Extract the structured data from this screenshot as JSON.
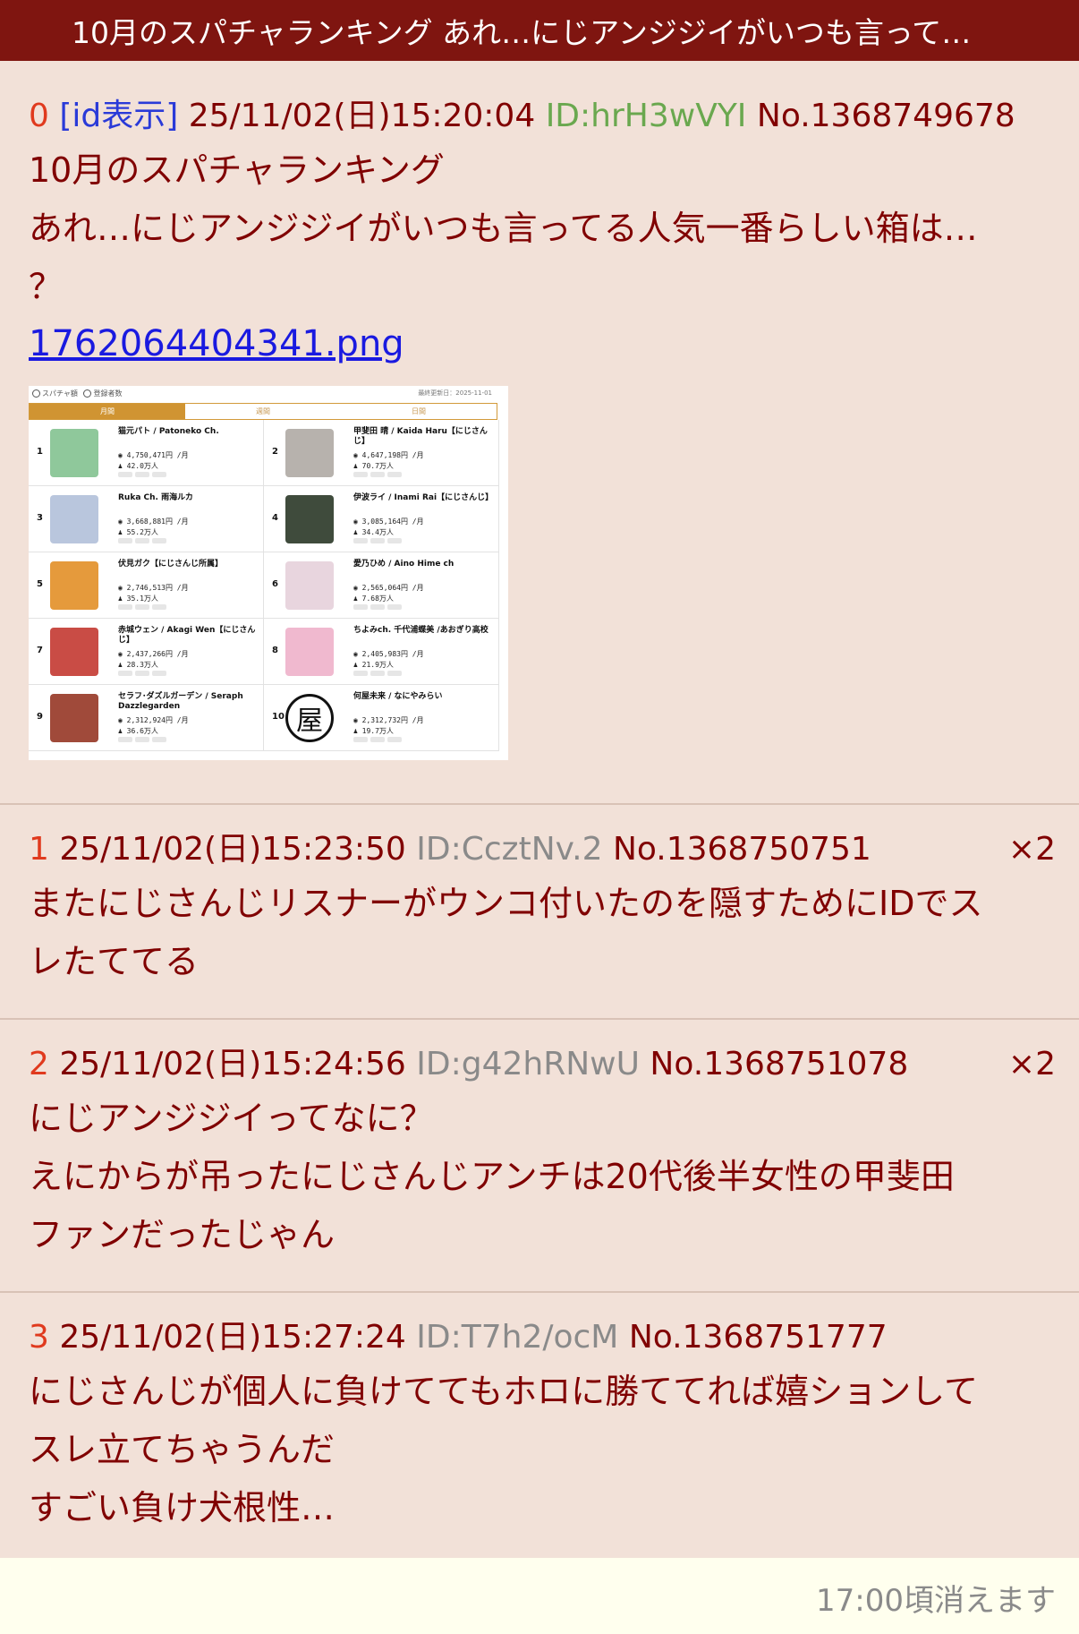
{
  "header": {
    "title": "10月のスパチャランキング あれ…にじアンジジイがいつも言って…"
  },
  "op": {
    "num": "0",
    "id_toggle": "[id表示]",
    "datetime": "25/11/02(日)15:20:04",
    "uid": "ID:hrH3wVYI",
    "no": "No.1368749678",
    "lines": [
      "10月のスパチャランキング",
      "あれ…にじアンジジイがいつも言ってる人気一番らしい箱は…",
      "？"
    ],
    "file": "1762064404341.png",
    "thumb": {
      "radio_label": "スパチャ額",
      "radio_label2": "登録者数",
      "date": "最終更新日：2025-11-01",
      "tabs": [
        "月間",
        "週間",
        "日間"
      ],
      "entries": [
        {
          "rank": "1",
          "name": "猫元パト / Patoneko Ch.",
          "amount": "4,750,471円 /月",
          "subs": "42.0万人",
          "color": "#8fc89b"
        },
        {
          "rank": "2",
          "name": "甲斐田 晴 / Kaida Haru【にじさんじ】",
          "amount": "4,647,198円 /月",
          "subs": "70.7万人",
          "color": "#b7b2ad"
        },
        {
          "rank": "3",
          "name": "Ruka Ch. 雨海ルカ",
          "amount": "3,668,881円 /月",
          "subs": "55.2万人",
          "color": "#b9c6dd"
        },
        {
          "rank": "4",
          "name": "伊波ライ / Inami Rai【にじさんじ】",
          "amount": "3,085,164円 /月",
          "subs": "34.4万人",
          "color": "#3f4b3c"
        },
        {
          "rank": "5",
          "name": "伏見ガク【にじさんじ所属】",
          "amount": "2,746,513円 /月",
          "subs": "35.1万人",
          "color": "#e59a3c"
        },
        {
          "rank": "6",
          "name": "愛乃ひめ / Aino Hime ch",
          "amount": "2,565,064円 /月",
          "subs": "7.68万人",
          "color": "#e8d5de"
        },
        {
          "rank": "7",
          "name": "赤城ウェン / Akagi Wen【にじさんじ】",
          "amount": "2,437,266円 /月",
          "subs": "28.3万人",
          "color": "#c94c45"
        },
        {
          "rank": "8",
          "name": "ちよみch. 千代浦蝶美 /あおぎり高校",
          "amount": "2,405,983円 /月",
          "subs": "21.9万人",
          "color": "#f0b9cf"
        },
        {
          "rank": "9",
          "name": "セラフ･ダズルガーデン / Seraph Dazzlegarden",
          "amount": "2,312,924円 /月",
          "subs": "36.6万人",
          "color": "#a04a3a"
        },
        {
          "rank": "10",
          "name": "何屋未来 / なにやみらい",
          "amount": "2,312,732円 /月",
          "subs": "19.7万人",
          "color": "#ffffff",
          "logo": "屋"
        }
      ]
    }
  },
  "replies": [
    {
      "num": "1",
      "datetime": "25/11/02(日)15:23:50",
      "uid": "ID:CcztNv.2",
      "no": "No.1368750751",
      "count": "×2",
      "lines": [
        "またにじさんじリスナーがウンコ付いたのを隠すためにIDでス",
        "レたててる"
      ]
    },
    {
      "num": "2",
      "datetime": "25/11/02(日)15:24:56",
      "uid": "ID:g42hRNwU",
      "no": "No.1368751078",
      "count": "×2",
      "lines": [
        "にじアンジジイってなに？",
        "えにからが吊ったにじさんじアンチは20代後半女性の甲斐田",
        "ファンだったじゃん"
      ]
    },
    {
      "num": "3",
      "datetime": "25/11/02(日)15:27:24",
      "uid": "ID:T7h2/ocM",
      "no": "No.1368751777",
      "count": "",
      "lines": [
        "にじさんじが個人に負けててもホロに勝ててれば嬉ションして",
        "スレ立てちゃうんだ",
        "すごい負け犬根性…"
      ]
    }
  ],
  "footer": {
    "expire": "17:00頃消えます"
  }
}
